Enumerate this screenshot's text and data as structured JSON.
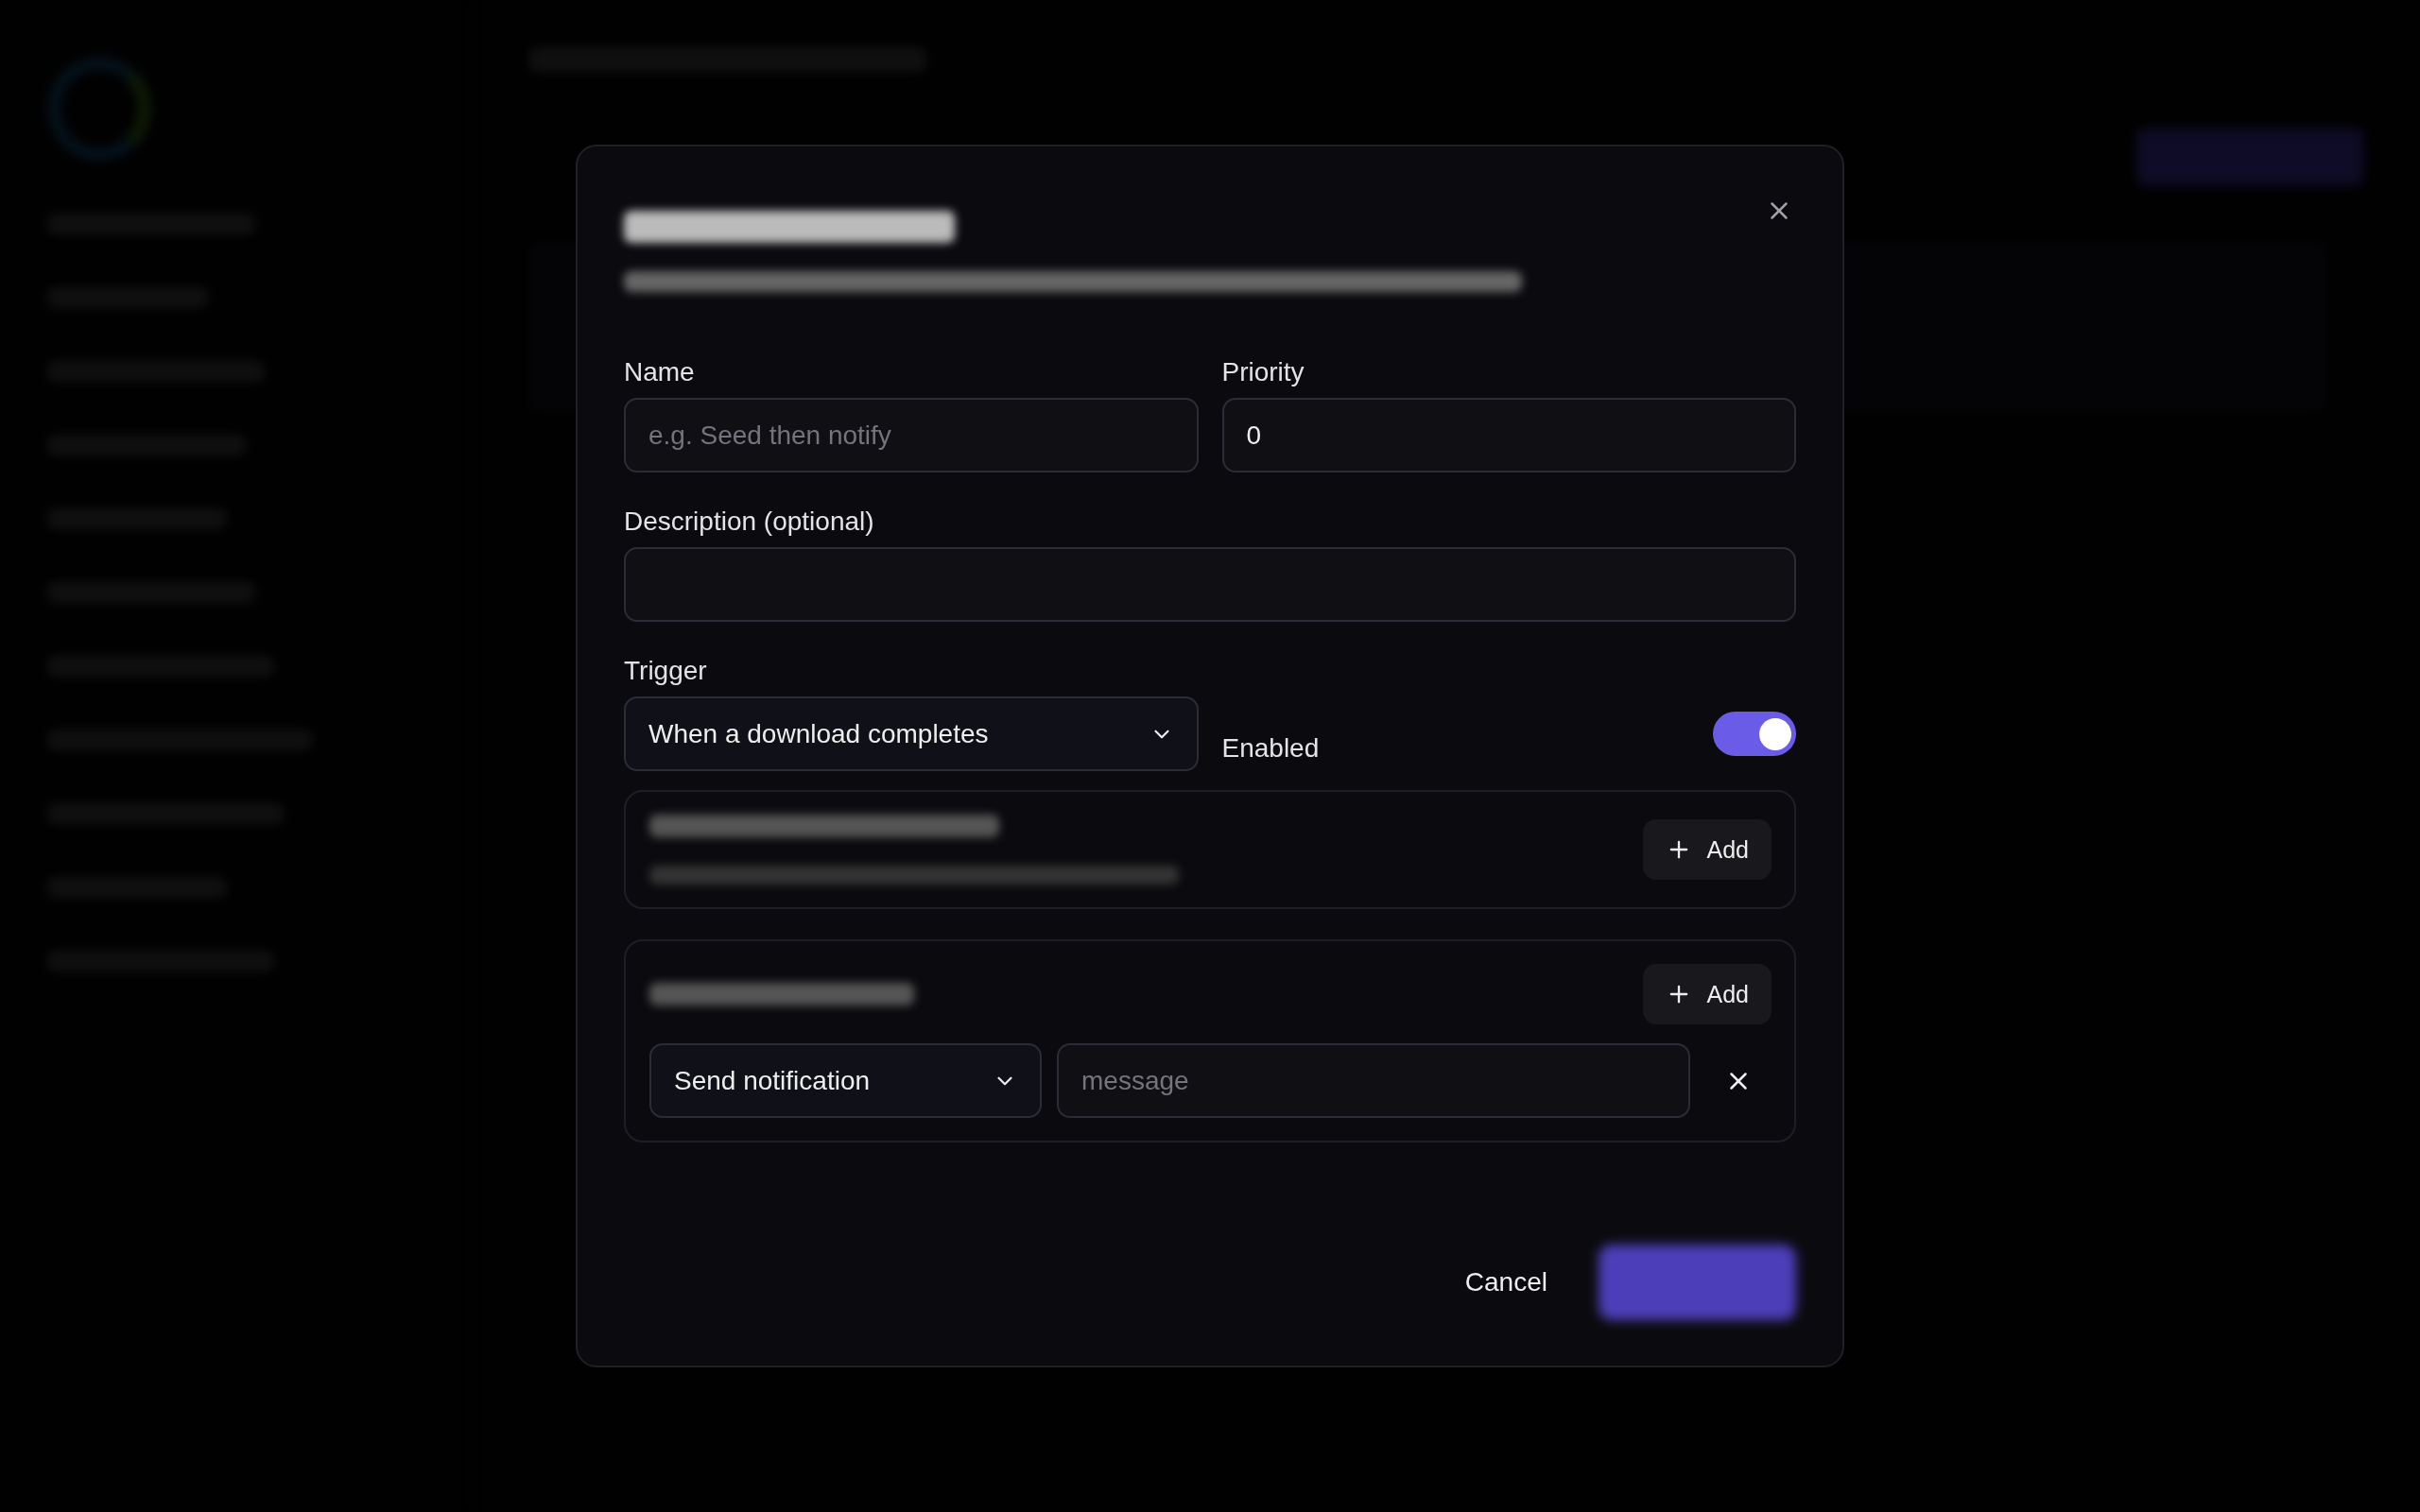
{
  "dialog": {
    "fields": [
      {
        "label": "Name",
        "placeholder": "e.g. Seed then notify"
      },
      {
        "label": "Priority",
        "value": "0"
      }
    ],
    "description": {
      "label": "Description (optional)"
    },
    "trigger": {
      "label": "Trigger",
      "value": "When a download completes"
    },
    "enabled": {
      "label": "Enabled",
      "on": true
    },
    "sections": [
      {
        "add_label": "Add"
      },
      {
        "add_label": "Add",
        "actions": [
          {
            "type": "Send notification",
            "placeholder": "message"
          }
        ]
      }
    ],
    "cancel": "Cancel"
  }
}
